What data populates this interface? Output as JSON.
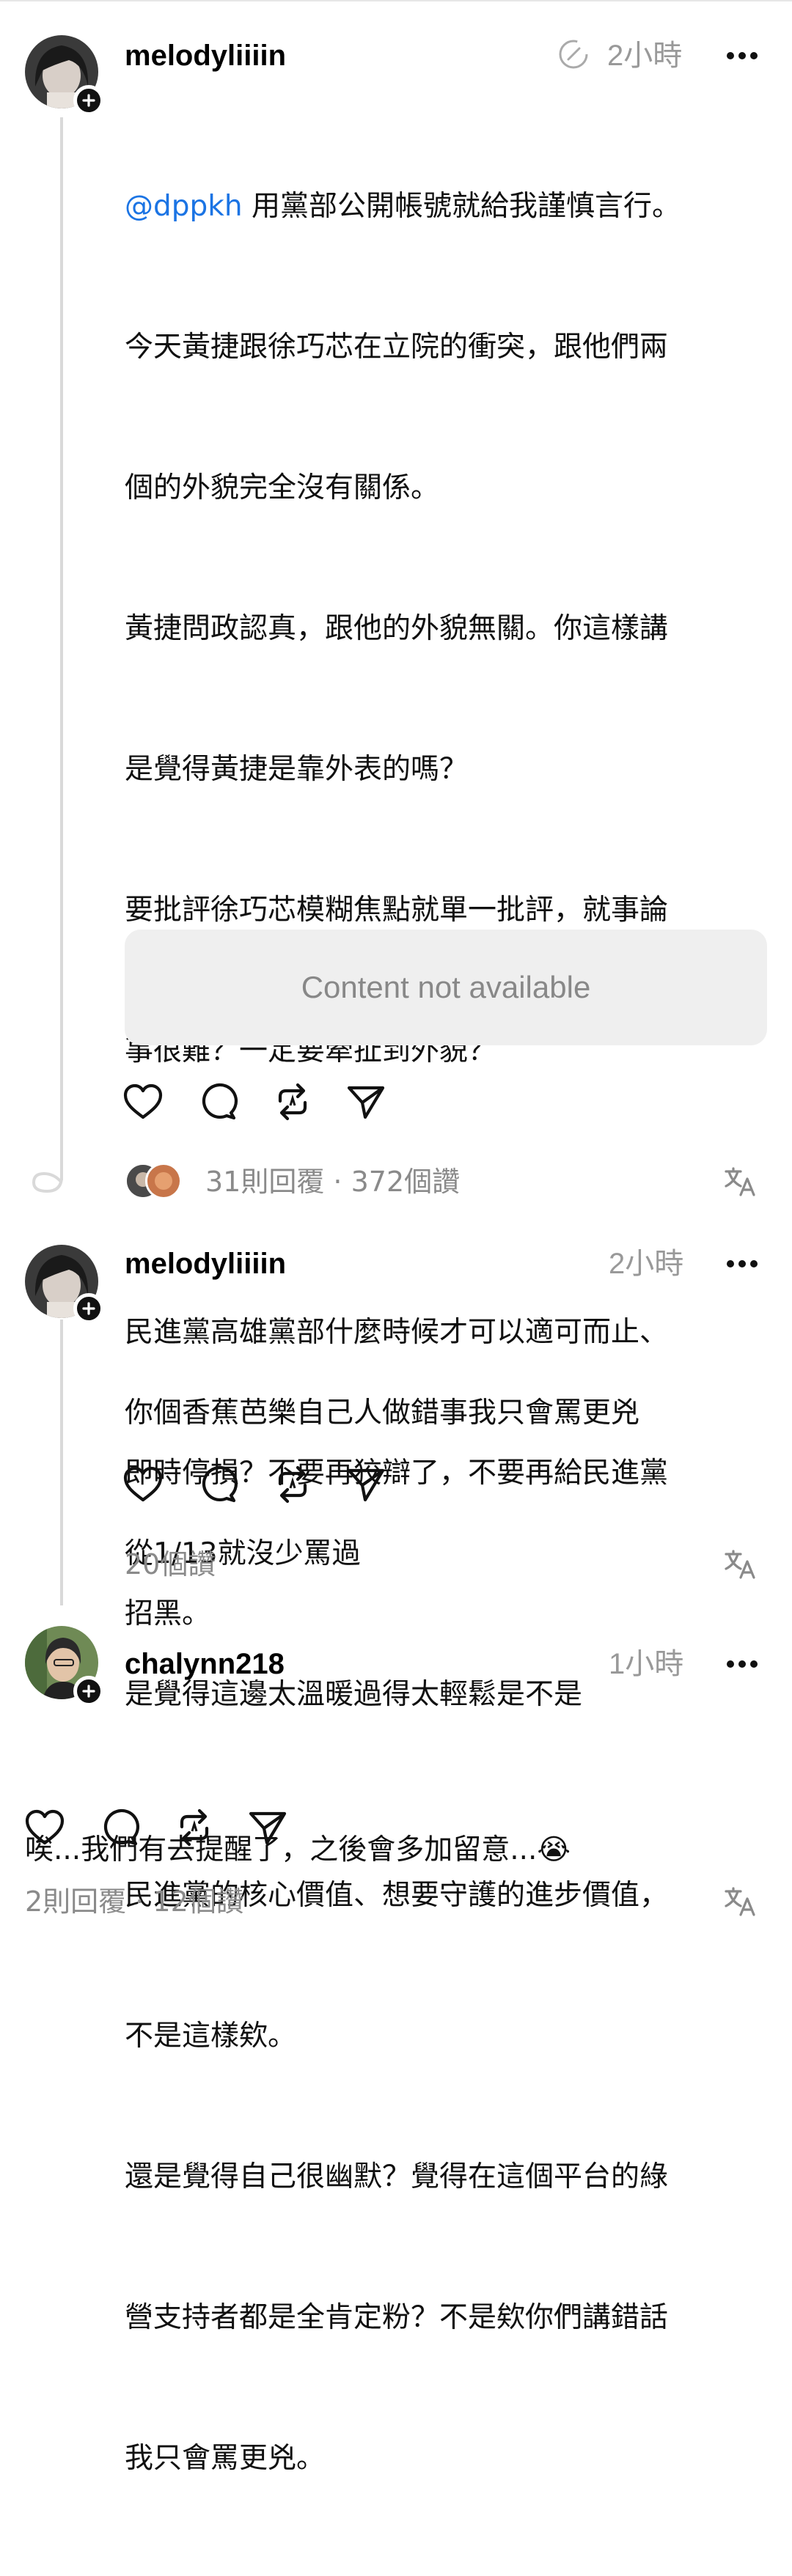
{
  "posts": [
    {
      "username": "melodyliiiin",
      "time": "2小時",
      "mention": "@dppkh",
      "lines": [
        " 用黨部公開帳號就給我謹慎言行。",
        "今天黃捷跟徐巧芯在立院的衝突，跟他們兩",
        "個的外貌完全沒有關係。",
        "黃捷問政認真，跟他的外貌無關。你這樣講",
        "是覺得黃捷是靠外表的嗎？",
        "要批評徐巧芯模糊焦點就單一批評，就事論",
        "事很難？一定要牽扯到外貌？",
        "",
        "民進黨高雄黨部什麼時候才可以適可而止、",
        "即時停損？不要再狡辯了，不要再給民進黨",
        "招黑。",
        "",
        "民進黨的核心價值、想要守護的進步價值，",
        "不是這樣欸。",
        "還是覺得自己很幽默？覺得在這個平台的綠",
        "營支持者都是全肯定粉？不是欸你們講錯話",
        "我只會罵更兇。"
      ],
      "quote_text": "Content not available",
      "stats": "31則回覆 · 372個讚"
    },
    {
      "username": "melodyliiiin",
      "time": "2小時",
      "lines": [
        "你個香蕉芭樂自己人做錯事我只會罵更兇",
        "從1/13就沒少罵過",
        "是覺得這邊太溫暖過得太輕鬆是不是"
      ],
      "stats": "20個讚"
    },
    {
      "username": "chalynn218",
      "time": "1小時",
      "lines": [
        "唉...我們有去提醒了，之後會多加留意...😭"
      ],
      "stats": "2則回覆 · 12個讚"
    }
  ],
  "icons": [
    "edit-circle-icon",
    "more-icon",
    "heart-icon",
    "comment-icon",
    "repost-icon",
    "share-icon",
    "translate-icon"
  ],
  "colors": {
    "mention": "#1b74e4",
    "muted": "#999999",
    "unavailable_bg": "#efefef"
  }
}
